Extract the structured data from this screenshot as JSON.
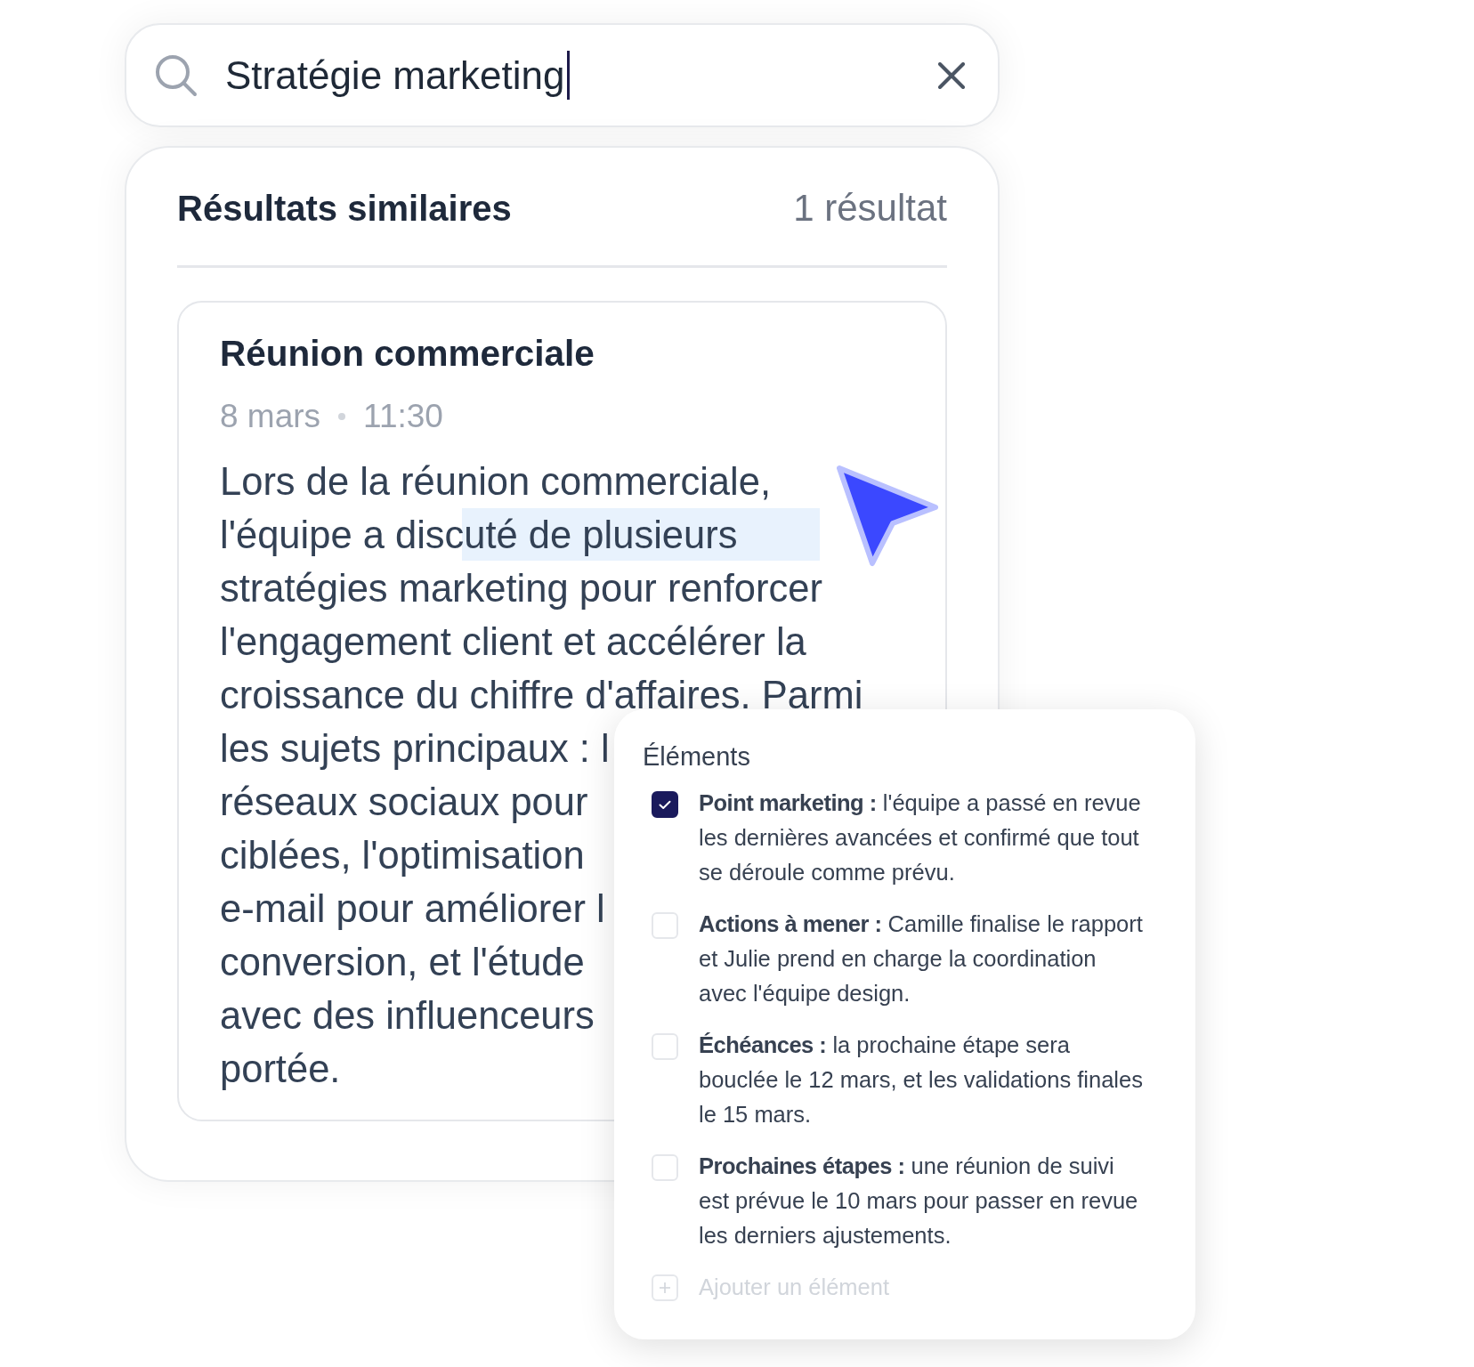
{
  "search": {
    "value": "Stratégie marketing",
    "focused": true
  },
  "results": {
    "title": "Résultats similaires",
    "count": "1 résultat",
    "card": {
      "title": "Réunion commerciale",
      "date": "8 mars",
      "time": "11:30",
      "body_lines": [
        {
          "text": "Lors de la réunion commerciale,",
          "highlighted": false
        },
        {
          "text": "l'équipe a discuté de plusieurs",
          "highlighted": true
        },
        {
          "text": "stratégies marketing pour renforcer",
          "highlighted": false
        },
        {
          "text": "l'engagement client et accélérer la",
          "highlighted": false
        },
        {
          "text": "croissance du chiffre d'affaires. Parmi",
          "highlighted": false
        },
        {
          "text": "les sujets principaux : l",
          "highlighted": false
        },
        {
          "text": "réseaux sociaux pour",
          "highlighted": false
        },
        {
          "text": "ciblées, l'optimisation",
          "highlighted": false
        },
        {
          "text": "e-mail pour améliorer l",
          "highlighted": false
        },
        {
          "text": "conversion, et l'étude",
          "highlighted": false
        },
        {
          "text": "avec des influenceurs",
          "highlighted": false
        },
        {
          "text": "portée.",
          "highlighted": false
        }
      ]
    }
  },
  "popup": {
    "title": "Éléments",
    "items": [
      {
        "text": "**Point marketing :** l'équipe a passé en revue les dernières avancées et confirmé que tout se déroule comme prévu.",
        "checked": true
      },
      {
        "text": "**Actions à mener :** Camille finalise le rapport et Julie prend en charge la coordination avec l'équipe design.",
        "checked": false
      },
      {
        "text": "**Échéances :** la prochaine étape sera bouclée le 12 mars, et les validations finales le 15 mars.",
        "checked": false
      },
      {
        "text": "**Prochaines étapes :** une réunion de suivi est prévue le 10 mars pour passer en revue les derniers ajustements.",
        "checked": false
      }
    ],
    "add_label": "Ajouter un élément"
  }
}
